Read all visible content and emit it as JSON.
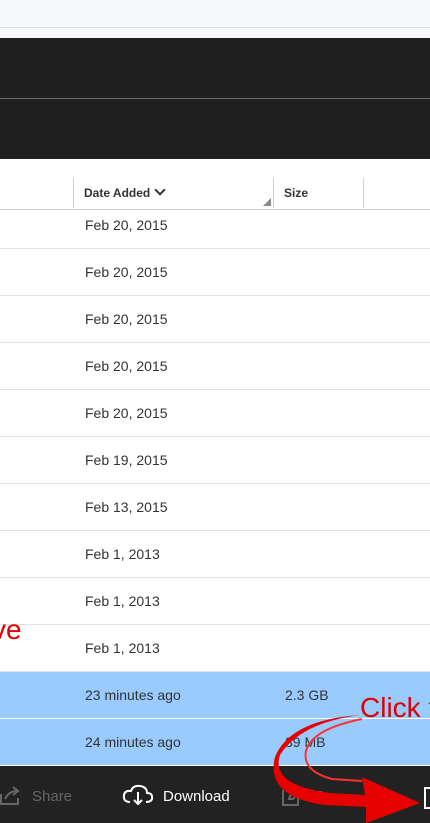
{
  "table": {
    "columns": {
      "date_added": "Date Added",
      "size": "Size"
    },
    "rows": [
      {
        "date": "Feb 20, 2015",
        "size": "",
        "selected": false
      },
      {
        "date": "Feb 20, 2015",
        "size": "",
        "selected": false
      },
      {
        "date": "Feb 20, 2015",
        "size": "",
        "selected": false
      },
      {
        "date": "Feb 20, 2015",
        "size": "",
        "selected": false
      },
      {
        "date": "Feb 20, 2015",
        "size": "",
        "selected": false
      },
      {
        "date": "Feb 19, 2015",
        "size": "",
        "selected": false
      },
      {
        "date": "Feb 13, 2015",
        "size": "",
        "selected": false
      },
      {
        "date": "Feb 1, 2013",
        "size": "",
        "selected": false
      },
      {
        "date": "Feb 1, 2013",
        "size": "",
        "selected": false
      },
      {
        "date": "Feb 1, 2013",
        "size": "",
        "selected": false
      },
      {
        "date": "23 minutes ago",
        "size": "2.3 GB",
        "selected": true
      },
      {
        "date": "24 minutes ago",
        "size": "39 MB",
        "selected": true
      }
    ]
  },
  "toolbar": {
    "share_label": "Share",
    "download_label": "Download",
    "rename_label": "Re"
  },
  "annotations": {
    "left_text": "ve",
    "right_text": "Click t",
    "color": "#e00000"
  },
  "colors": {
    "selected_row": "#99cbff",
    "dark_bar": "#1f1f1f"
  }
}
